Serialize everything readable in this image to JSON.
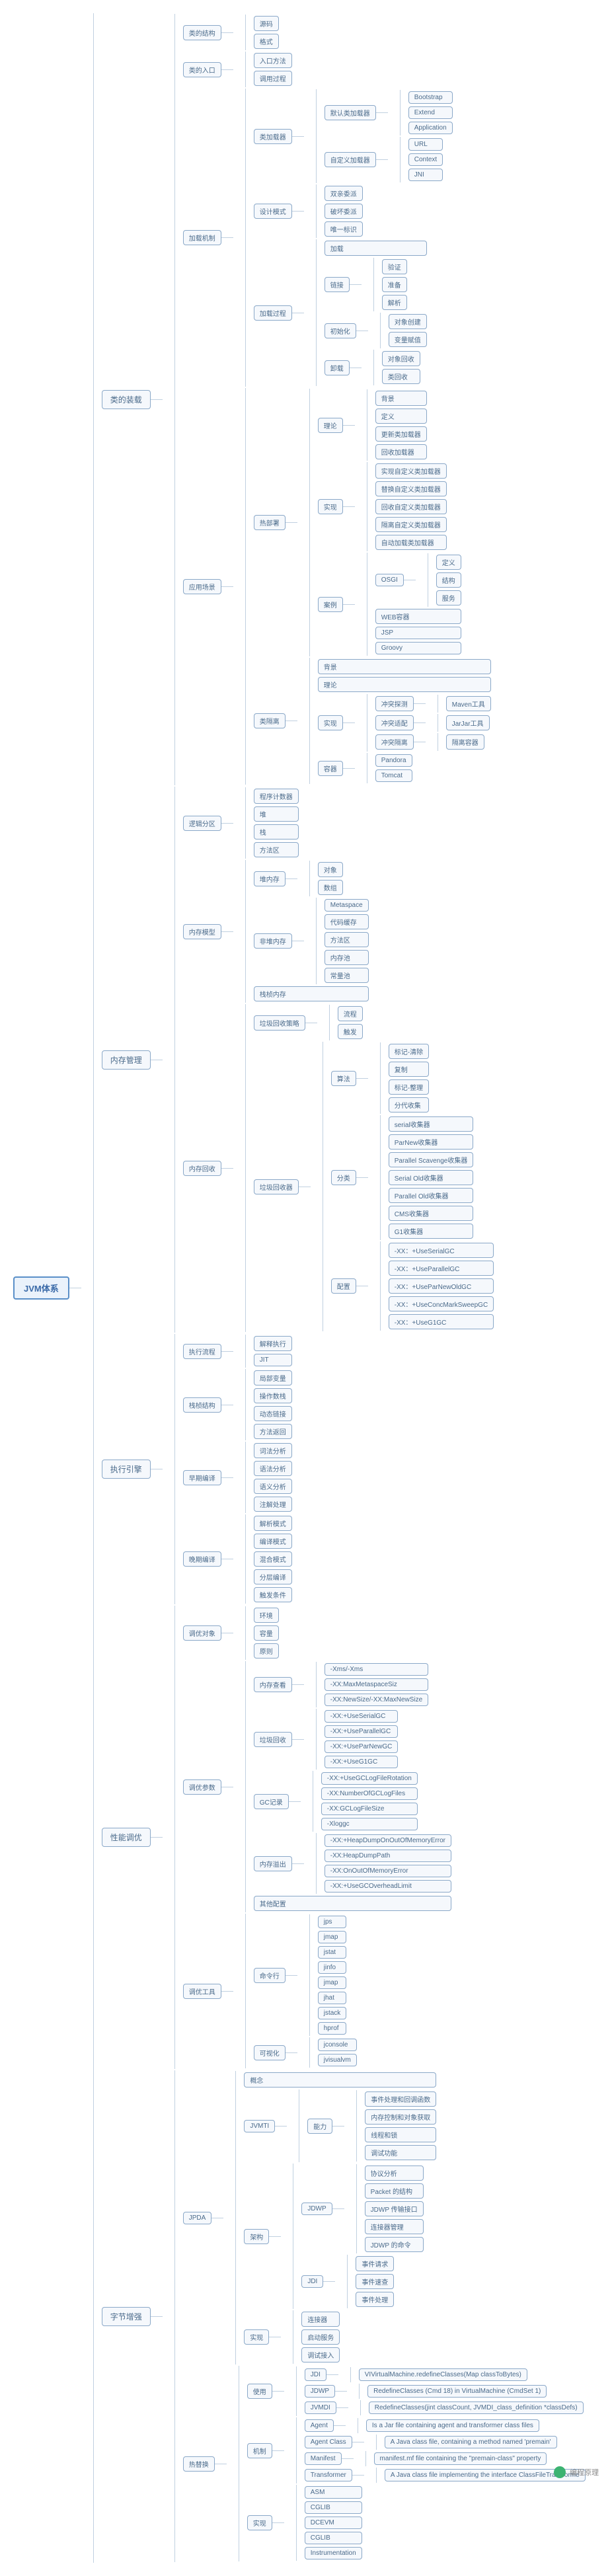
{
  "root": "JVM体系",
  "main": [
    {
      "id": "classload",
      "label": "类的装载"
    },
    {
      "id": "memory",
      "label": "内存管理"
    },
    {
      "id": "engine",
      "label": "执行引擎"
    },
    {
      "id": "perf",
      "label": "性能调优"
    },
    {
      "id": "bytecode",
      "label": "字节增强"
    }
  ],
  "classload": {
    "struct": {
      "label": "类的结构",
      "children": [
        "源码",
        "格式"
      ]
    },
    "entry": {
      "label": "类的入口",
      "children": [
        "入口方法",
        "调用过程"
      ]
    },
    "mech": {
      "label": "加载机制",
      "loaders": {
        "label": "类加载器",
        "def": {
          "label": "默认类加载器",
          "items": [
            "Bootstrap",
            "Extend",
            "Application"
          ]
        },
        "custom": {
          "label": "自定义加载器",
          "items": [
            "URL",
            "Context",
            "JNI"
          ]
        }
      },
      "design": {
        "label": "设计模式",
        "items": [
          "双亲委派",
          "破坏委派",
          "唯一标识"
        ]
      },
      "process": {
        "label": "加载过程",
        "load": "加载",
        "link": {
          "label": "链接",
          "items": [
            "验证",
            "准备",
            "解析"
          ]
        },
        "init": {
          "label": "初始化",
          "items": [
            "对象创建",
            "变量赋值"
          ]
        },
        "unload": {
          "label": "卸载",
          "items": [
            "对象回收",
            "类回收"
          ]
        }
      }
    },
    "app": {
      "label": "应用场景",
      "hot": {
        "label": "热部署",
        "concept": {
          "label": "理论",
          "items": [
            "背景",
            "定义",
            "更新类加载器",
            "回收加载器"
          ]
        },
        "impl": {
          "label": "实现",
          "items": [
            "实现自定义类加载器",
            "替换自定义类加载器",
            "回收自定义类加载器",
            "隔离自定义类加载器",
            "自动加载类加载器"
          ]
        },
        "cases": {
          "label": "案例",
          "osgi": {
            "label": "OSGI",
            "items": [
              "定义",
              "结构",
              "服务"
            ]
          },
          "other": [
            "WEB容器",
            "JSP",
            "Groovy"
          ]
        }
      },
      "iso": {
        "label": "类隔离",
        "items": [
          "背景",
          "理论"
        ],
        "impl": {
          "label": "实现",
          "conflict": {
            "label": "冲突探测",
            "items": [
              "Maven工具"
            ]
          },
          "adapt": {
            "label": "冲突适配",
            "items": [
              "JarJar工具"
            ]
          },
          "isolate": {
            "label": "冲突隔离",
            "items": [
              "隔离容器"
            ]
          }
        },
        "container": {
          "label": "容器",
          "items": [
            "Pandora",
            "Tomcat"
          ]
        }
      }
    }
  },
  "memory": {
    "logic": {
      "label": "逻辑分区",
      "items": [
        "程序计数器",
        "堆",
        "栈",
        "方法区"
      ]
    },
    "model": {
      "label": "内存模型",
      "heap": {
        "label": "堆内存",
        "items": [
          "对象",
          "数组"
        ]
      },
      "nonheap": {
        "label": "非堆内存",
        "items": [
          "Metaspace",
          "代码缓存",
          "方法区",
          "内存池",
          "常量池"
        ]
      },
      "stack": "栈桢内存"
    },
    "gc": {
      "label": "内存回收",
      "policy": {
        "label": "垃圾回收策略",
        "items": [
          "流程",
          "触发"
        ]
      },
      "collector": {
        "label": "垃圾回收器",
        "algo": {
          "label": "算法",
          "items": [
            "标记-清除",
            "复制",
            "标记-整理",
            "分代收集"
          ]
        },
        "types": {
          "label": "分类",
          "items": [
            "serial收集器",
            "ParNew收集器",
            "Parallel Scavenge收集器",
            "Serial Old收集器",
            "Parallel Old收集器",
            "CMS收集器",
            "G1收集器"
          ]
        },
        "config": {
          "label": "配置",
          "items": [
            "-XX：+UseSerialGC",
            "-XX：+UseParallelGC",
            "-XX：+UseParNewOldGC",
            "-XX：+UseConcMarkSweepGC",
            "-XX：+UseG1GC"
          ]
        }
      }
    }
  },
  "engine": {
    "flow": {
      "label": "执行流程",
      "items": [
        "解释执行",
        "JIT"
      ]
    },
    "stack": {
      "label": "栈桢结构",
      "items": [
        "局部变量",
        "操作数栈",
        "动态链接",
        "方法返回"
      ]
    },
    "bind": {
      "label": "早期编译",
      "items": [
        "词法分析",
        "语法分析",
        "语义分析",
        "注解处理"
      ]
    },
    "late": {
      "label": "晚期编译",
      "items": [
        "解析模式",
        "编译模式",
        "混合模式",
        "分层编译",
        "触发条件"
      ]
    }
  },
  "perf": {
    "obj": {
      "label": "调优对象",
      "items": [
        "环境",
        "容量",
        "原则"
      ]
    },
    "params": {
      "label": "调优参数",
      "mem": {
        "label": "内存查看",
        "items": [
          "-Xms/-Xms",
          "-XX:MaxMetaspaceSiz",
          "-XX:NewSize/-XX:MaxNewSize"
        ]
      },
      "gc": {
        "label": "垃圾回收",
        "items": [
          "-XX:+UseSerialGC",
          "-XX:+UseParallelGC",
          "-XX:+UseParNewGC",
          "-XX:+UseG1GC",
          "-XX:+UseGCLogFileRotation",
          "-XX:NumberOfGCLogFiles",
          "-XX:GCLogFileSize",
          "-Xloggc"
        ]
      },
      "gcrec": "GC记录",
      "oom": {
        "label": "内存溢出",
        "items": [
          "-XX:+HeapDumpOnOutOfMemoryError",
          "-XX:HeapDumpPath",
          "-XX:OnOutOfMemoryError",
          "-XX:+UseGCOverheadLimit"
        ]
      },
      "other": "其他配置"
    },
    "tools": {
      "label": "调优工具",
      "cli": {
        "label": "命令行",
        "items": [
          "jps",
          "jmap",
          "jstat",
          "jinfo",
          "jmap",
          "jhat",
          "jstack",
          "hprof"
        ]
      },
      "viz": {
        "label": "可视化",
        "items": [
          "jconsole",
          "jvisualvm"
        ]
      }
    }
  },
  "bytecode": {
    "jpda": {
      "label": "JPDA",
      "concept": "概念",
      "jvmti": {
        "label": "JVMTI",
        "cap": {
          "label": "能力",
          "items": [
            "事件处理和回调函数",
            "内存控制和对象获取",
            "线程和锁",
            "调试功能"
          ]
        }
      },
      "arch": {
        "label": "架构",
        "jdwp": {
          "label": "JDWP",
          "items": [
            "协议分析",
            "Packet 的结构",
            "JDWP 传输接口",
            "连接器管理",
            "JDWP 的命令"
          ]
        },
        "jdi": {
          "label": "JDI",
          "items": [
            "事件请求",
            "事件速查",
            "事件处理"
          ]
        }
      },
      "impl": {
        "label": "实现",
        "items": [
          "连接器",
          "启动服务",
          "调试接入"
        ]
      }
    },
    "hot": {
      "label": "热替换",
      "use": {
        "label": "使用",
        "jdi": {
          "label": "JDI",
          "val": "VIVirtualMachine.redefineClasses(Map classToBytes)"
        },
        "jdwp": {
          "label": "JDWP",
          "val": "RedefineClasses (Cmd 18) in VirtualMachine (CmdSet 1)"
        },
        "jvmdi": {
          "label": "JVMDI",
          "val": "RedefineClasses(jint classCount, JVMDI_class_definition *classDefs)"
        }
      },
      "mech": {
        "label": "机制",
        "items": [
          {
            "k": "Agent",
            "v": "Is a Jar file containing agent and transformer class files"
          },
          {
            "k": "Agent Class",
            "v": "A Java class file, containing a method named 'premain'"
          },
          {
            "k": "Manifest",
            "v": "manifest.mf file containing the \"premain-class\" property"
          },
          {
            "k": "Transformer",
            "v": "A Java class file implementing the interface ClassFileTransforme"
          }
        ]
      },
      "impl": {
        "label": "实现",
        "items": [
          "ASM",
          "CGLIB",
          "DCEVM",
          "CGLIB",
          "Instrumentation"
        ]
      }
    }
  },
  "footer": "编程原理"
}
